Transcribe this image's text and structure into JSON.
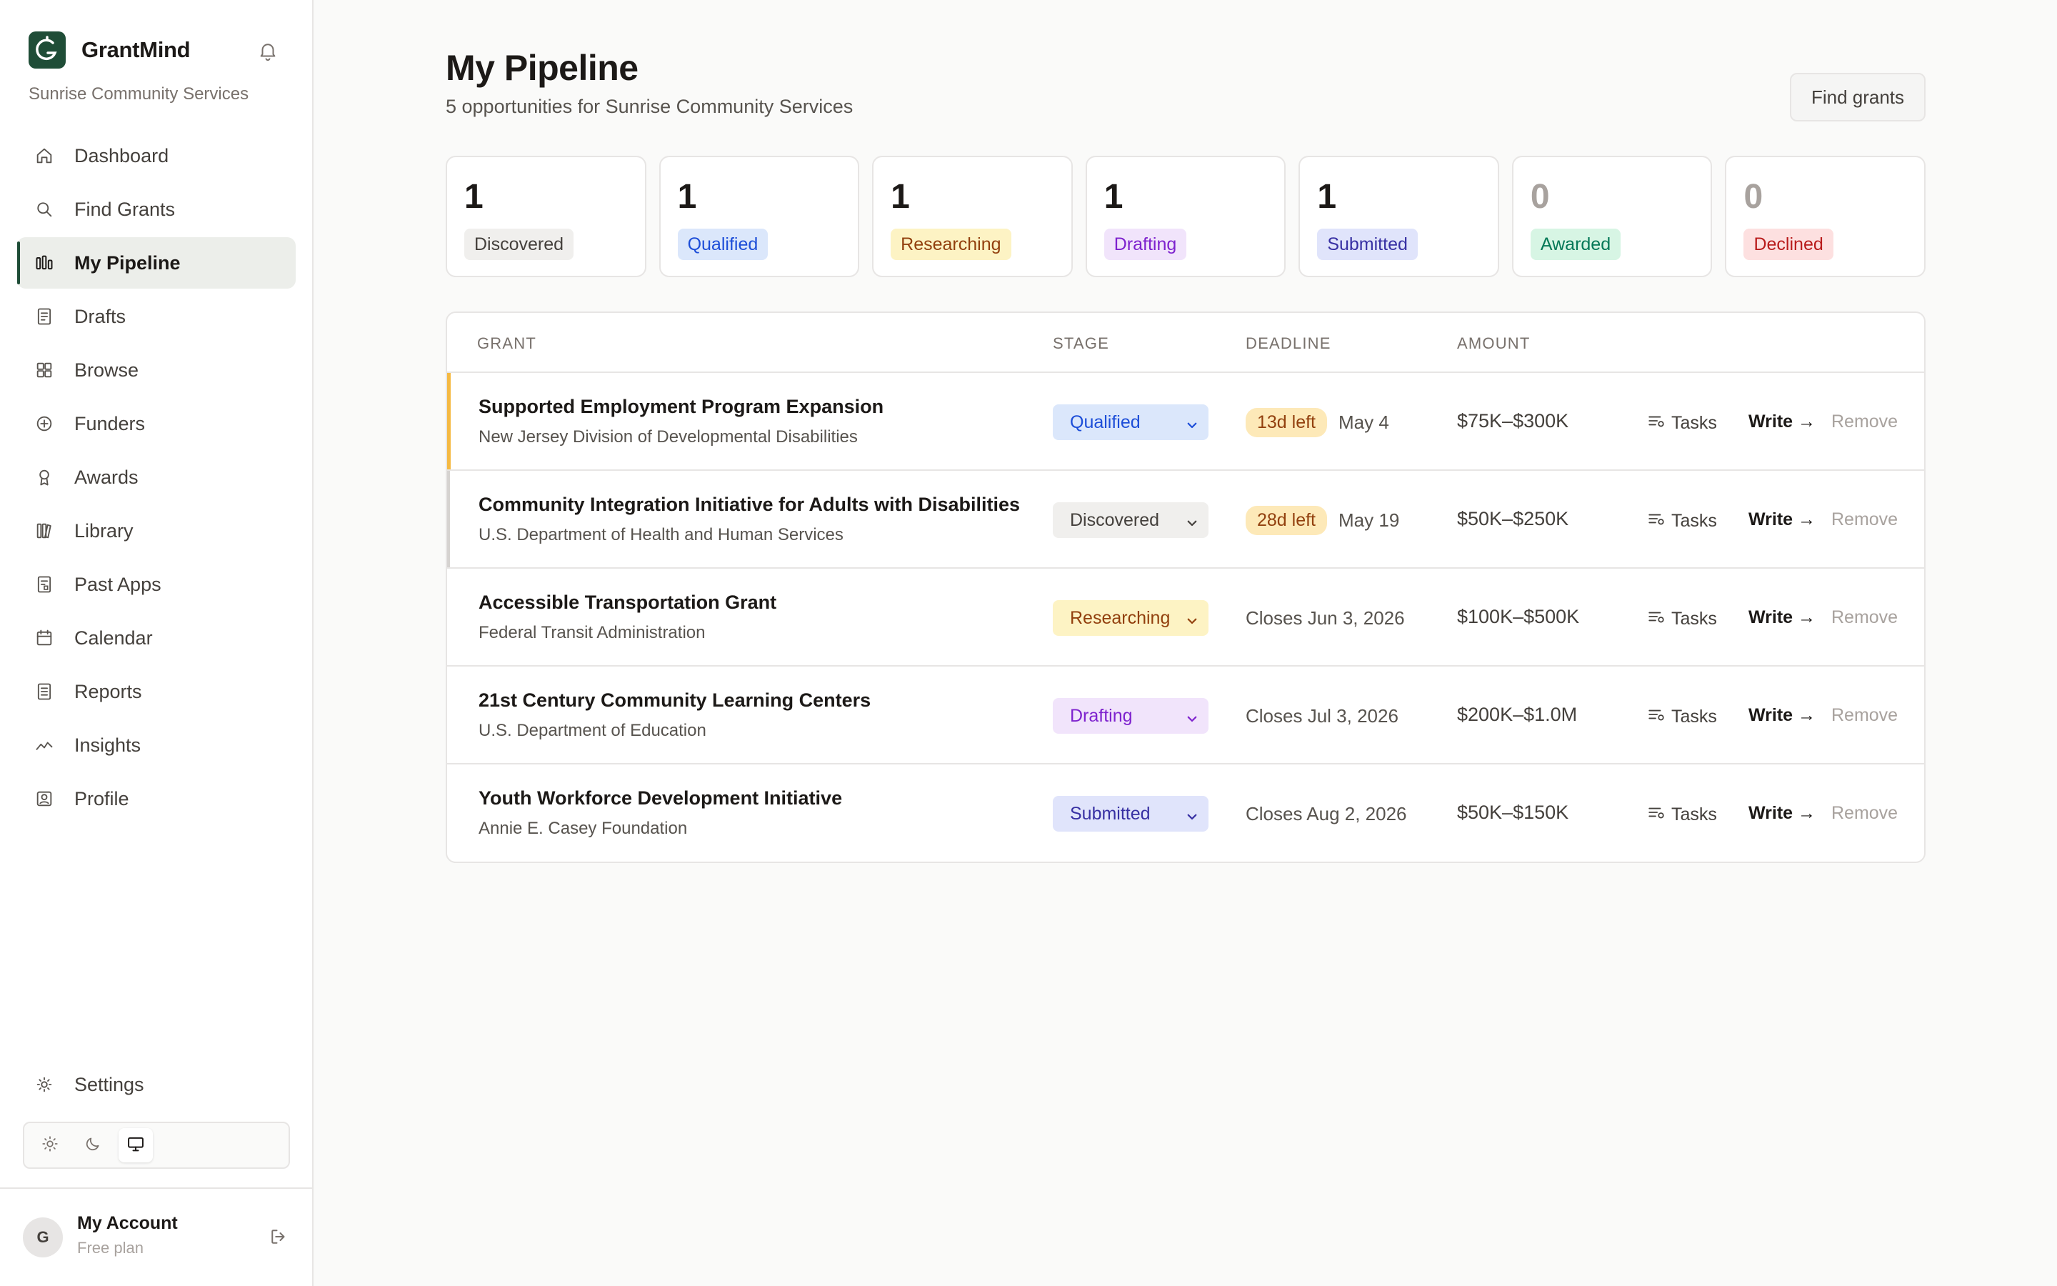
{
  "app": {
    "brand": "GrantMind",
    "org": "Sunrise Community Services"
  },
  "nav": {
    "items": [
      {
        "label": "Dashboard",
        "icon": "home-icon"
      },
      {
        "label": "Find Grants",
        "icon": "search-icon"
      },
      {
        "label": "My Pipeline",
        "icon": "pipeline-icon",
        "active": true
      },
      {
        "label": "Drafts",
        "icon": "document-icon"
      },
      {
        "label": "Browse",
        "icon": "grid-icon"
      },
      {
        "label": "Funders",
        "icon": "plus-circle-icon"
      },
      {
        "label": "Awards",
        "icon": "award-icon"
      },
      {
        "label": "Library",
        "icon": "library-icon"
      },
      {
        "label": "Past Apps",
        "icon": "archive-icon"
      },
      {
        "label": "Calendar",
        "icon": "calendar-icon"
      },
      {
        "label": "Reports",
        "icon": "report-icon"
      },
      {
        "label": "Insights",
        "icon": "trend-icon"
      },
      {
        "label": "Profile",
        "icon": "profile-icon"
      }
    ],
    "settings": "Settings"
  },
  "account": {
    "initial": "G",
    "name": "My Account",
    "plan": "Free plan"
  },
  "page": {
    "title": "My Pipeline",
    "subtitle": "5 opportunities for Sunrise Community Services",
    "find_button": "Find grants"
  },
  "stats": [
    {
      "count": "1",
      "label": "Discovered",
      "bg": "#f0efed",
      "fg": "#44403c"
    },
    {
      "count": "1",
      "label": "Qualified",
      "bg": "#dbe7fb",
      "fg": "#1d4ed8"
    },
    {
      "count": "1",
      "label": "Researching",
      "bg": "#fdf3c4",
      "fg": "#92400e"
    },
    {
      "count": "1",
      "label": "Drafting",
      "bg": "#f1e4fb",
      "fg": "#7e22ce"
    },
    {
      "count": "1",
      "label": "Submitted",
      "bg": "#e0e4fb",
      "fg": "#3730a3"
    },
    {
      "count": "0",
      "label": "Awarded",
      "bg": "#d7f5e4",
      "fg": "#047857"
    },
    {
      "count": "0",
      "label": "Declined",
      "bg": "#fde0e0",
      "fg": "#b91c1c"
    }
  ],
  "table": {
    "headers": [
      "GRANT",
      "STAGE",
      "DEADLINE",
      "AMOUNT"
    ],
    "actions": {
      "tasks": "Tasks",
      "write": "Write →",
      "remove": "Remove"
    },
    "rows": [
      {
        "name": "Supported Employment Program Expansion",
        "funder": "New Jersey Division of Developmental Disabilities",
        "stage": "Qualified",
        "stage_bg": "#dbe7fb",
        "stage_fg": "#1d4ed8",
        "pill": "13d left",
        "deadline": "May 4",
        "amount": "$75K–$300K"
      },
      {
        "name": "Community Integration Initiative for Adults with Disabilities",
        "funder": "U.S. Department of Health and Human Services",
        "stage": "Discovered",
        "stage_bg": "#f0efed",
        "stage_fg": "#44403c",
        "pill": "28d left",
        "deadline": "May 19",
        "amount": "$50K–$250K"
      },
      {
        "name": "Accessible Transportation Grant",
        "funder": "Federal Transit Administration",
        "stage": "Researching",
        "stage_bg": "#fdf3c4",
        "stage_fg": "#92400e",
        "pill": "",
        "deadline": "Closes Jun 3, 2026",
        "amount": "$100K–$500K"
      },
      {
        "name": "21st Century Community Learning Centers",
        "funder": "U.S. Department of Education",
        "stage": "Drafting",
        "stage_bg": "#f1e4fb",
        "stage_fg": "#7e22ce",
        "pill": "",
        "deadline": "Closes Jul 3, 2026",
        "amount": "$200K–$1.0M"
      },
      {
        "name": "Youth Workforce Development Initiative",
        "funder": "Annie E. Casey Foundation",
        "stage": "Submitted",
        "stage_bg": "#e0e4fb",
        "stage_fg": "#3730a3",
        "pill": "",
        "deadline": "Closes Aug 2, 2026",
        "amount": "$50K–$150K"
      }
    ]
  }
}
